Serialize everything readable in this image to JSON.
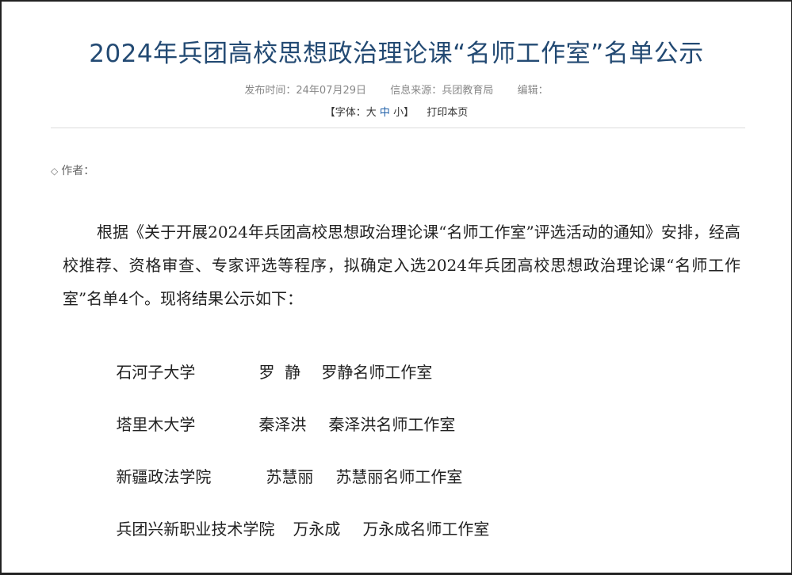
{
  "article": {
    "title": "2024年兵团高校思想政治理论课“名师工作室”名单公示",
    "meta": {
      "publish_label": "发布时间：",
      "publish_date": "24年07月29日",
      "source_label": "信息来源：",
      "source": "兵团教育局",
      "editor_label": "编辑："
    },
    "font_size": {
      "prefix": "【字体：",
      "large": "大",
      "medium": "中",
      "small": "小",
      "suffix": "】",
      "print": "打印本页"
    },
    "author_label": "作者：",
    "paragraph": "根据《关于开展2024年兵团高校思想政治理论课“名师工作室”评选活动的通知》安排，经高校推荐、资格审查、专家评选等程序，拟确定入选2024年兵团高校思想政治理论课“名师工作室”名单4个。现将结果公示如下：",
    "list": [
      {
        "school": "石河子大学",
        "teacher": "罗  静",
        "studio": "罗静名师工作室"
      },
      {
        "school": "塔里木大学",
        "teacher": "秦泽洪",
        "studio": "秦泽洪名师工作室"
      },
      {
        "school": "新疆政法学院",
        "teacher": "苏慧丽",
        "studio": "苏慧丽名师工作室"
      },
      {
        "school": "兵团兴新职业技术学院",
        "teacher": "万永成",
        "studio": "万永成名师工作室"
      }
    ]
  }
}
